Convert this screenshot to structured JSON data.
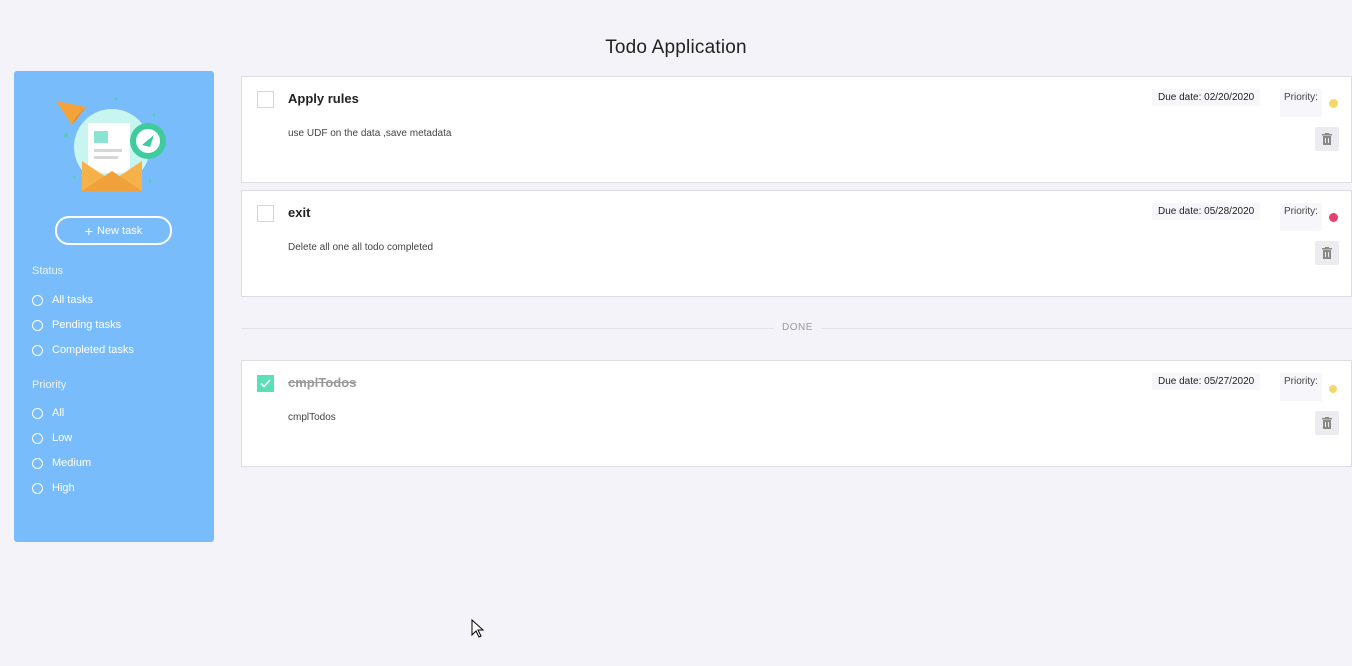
{
  "app": {
    "title": "Todo Application"
  },
  "sidebar": {
    "new_task_label": "New task",
    "status_label": "Status",
    "status_filters": [
      "All tasks",
      "Pending tasks",
      "Completed tasks"
    ],
    "priority_label": "Priority",
    "priority_filters": [
      "All",
      "Low",
      "Medium",
      "High"
    ]
  },
  "todos": [
    {
      "title": "Apply rules",
      "description": "use UDF on the data ,save metadata",
      "due_date": "Due date: 02/20/2020",
      "priority_label": "Priority:",
      "priority_color": "#f5d86a",
      "completed": false
    },
    {
      "title": "exit",
      "description": "Delete all one all todo completed",
      "due_date": "Due date: 05/28/2020",
      "priority_label": "Priority:",
      "priority_color": "#e8406d",
      "completed": false
    }
  ],
  "done_label": "DONE",
  "done_todos": [
    {
      "title": "cmplTodos",
      "description": "cmplTodos",
      "due_date": "Due date: 05/27/2020",
      "priority_label": "Priority:",
      "priority_color": "#f5d86a",
      "completed": true
    }
  ],
  "colors": {
    "sidebar_bg": "#79bcfb",
    "checked_green": "#59e0b8",
    "page_bg": "#f4f3fa"
  },
  "icons": [
    "plus-icon",
    "trash-icon",
    "checkmark-icon",
    "mail-illustration",
    "mouse-cursor-icon"
  ]
}
